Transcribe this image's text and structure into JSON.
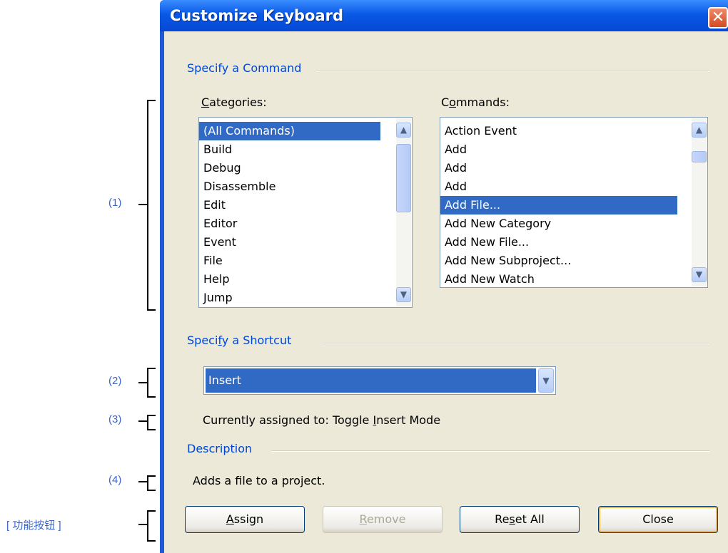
{
  "annotations": {
    "a1": "(1)",
    "a2": "(2)",
    "a3": "(3)",
    "a4": "(4)",
    "a5": "[ 功能按钮 ]"
  },
  "dialog": {
    "title": "Customize Keyboard",
    "close_glyph": "✕"
  },
  "command_group": {
    "title": "Specify a Command",
    "categories_label": "Categories:",
    "commands_label": "Commands:",
    "categories": [
      "(All Commands)",
      "Build",
      "Debug",
      "Disassemble",
      "Edit",
      "Editor",
      "Event",
      "File",
      "Help",
      "Jump"
    ],
    "commands": [
      "Action Event",
      "Add",
      "Add",
      "Add",
      "Add File...",
      "Add New Category",
      "Add New File...",
      "Add New Subproject...",
      "Add New Watch"
    ]
  },
  "shortcut_group": {
    "title": "Specify a Shortcut",
    "shortcut_value": "Insert",
    "assigned_prefix": "Currently assigned to: Toggle ",
    "assigned_cmd_first": "I",
    "assigned_cmd_rest": "nsert Mode"
  },
  "description_group": {
    "title": "Description",
    "text": "Adds a file to a project."
  },
  "buttons": {
    "assign": "Assign",
    "remove": "Remove",
    "reset_all": "Reset All",
    "close": "Close"
  },
  "icons": {
    "up": "▲",
    "down": "▼"
  }
}
